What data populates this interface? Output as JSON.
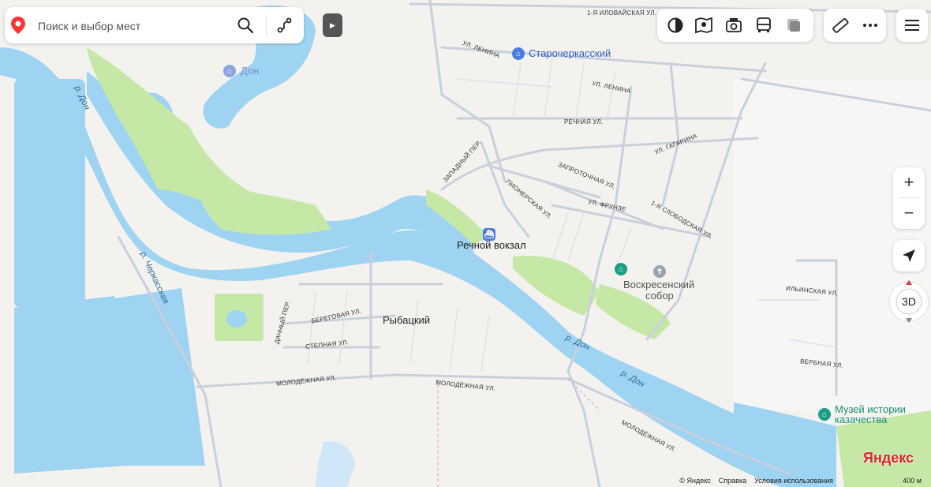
{
  "search": {
    "placeholder": "Поиск и выбор мест"
  },
  "toolbar": {
    "layers": [
      "layers-icon",
      "panorama-icon",
      "camera-icon",
      "transit-icon",
      "traffic-icon"
    ],
    "ruler": "ruler-icon",
    "more": "more-icon",
    "menu": "menu-icon"
  },
  "map_controls": {
    "zoom_in": "+",
    "zoom_out": "−",
    "three_d": "3D"
  },
  "places": {
    "starocherkassky": "Старочеркасский",
    "don_poi": "Дон",
    "rechnoy_vokzal": "Речной вокзал",
    "voskresensky_1": "Воскресенский",
    "voskresensky_2": "собор",
    "rybatsky": "Рыбацкий",
    "museum_1": "Музей истории",
    "museum_2": "казачества"
  },
  "rivers": {
    "don_top": "р. Дон",
    "don_mid": "р. Дон",
    "don_bottom": "р. Дон",
    "cherkasskaya": "р. Черкасская"
  },
  "streets": {
    "ilovaiskaya": "1-я Иловайская ул.",
    "lenina_1": "ул. Ленина",
    "lenina_2": "ул. Ленина",
    "rechnaya": "Речная ул.",
    "gagarina": "ул. Гагарина",
    "zapadny": "Западный пер.",
    "zaprotochnaya": "Запроточная ул.",
    "pionerskaya": "Пионерская ул.",
    "frunze": "ул. Фрунзе",
    "slobodskaya": "1-я Слободская ул.",
    "ilyinskaya": "Ильинская ул.",
    "verbnaya": "Вербная ул.",
    "dachny": "Дачный пер.",
    "beregovaya": "Береговая ул.",
    "stepnaya": "Степная ул.",
    "molodezhnaya_1": "Молодёжная ул.",
    "molodezhnaya_2": "Молодёжная ул.",
    "molodezhnaya_3": "Молодёжная ул."
  },
  "brand": "Яндекс",
  "footer": {
    "copyright": "© Яндекс",
    "help": "Справка",
    "terms": "Условия использования"
  },
  "scale": "400 м",
  "colors": {
    "water": "#9fd3f2",
    "park": "#c6e8a7",
    "road": "#c9cfdc",
    "land": "#f3f2ef",
    "search_pin": "#f33"
  }
}
